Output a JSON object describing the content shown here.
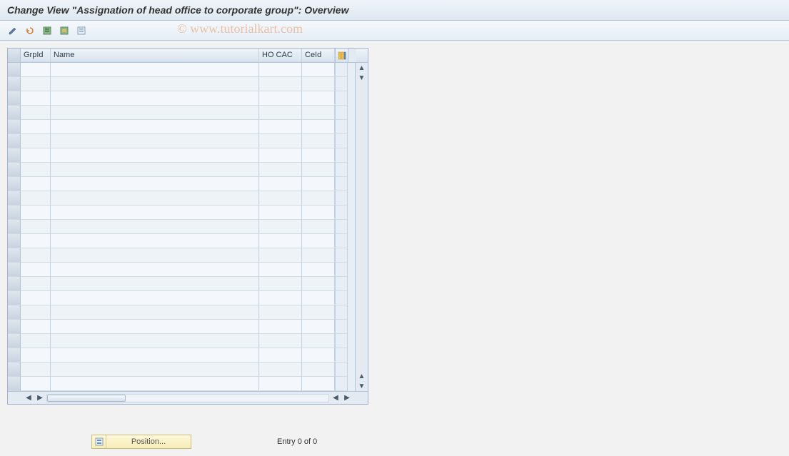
{
  "title": "Change View \"Assignation of head office to corporate group\": Overview",
  "watermark": "© www.tutorialkart.com",
  "toolbar": {
    "icons": [
      "edit-icon",
      "undo-icon",
      "select-all-icon",
      "select-block-icon",
      "deselect-icon"
    ]
  },
  "grid": {
    "columns": {
      "grpid": "GrpId",
      "name": "Name",
      "hocac": "HO CAC",
      "ceid": "CeId"
    },
    "row_count": 23
  },
  "footer": {
    "position_label": "Position...",
    "entry_text": "Entry 0 of 0"
  }
}
